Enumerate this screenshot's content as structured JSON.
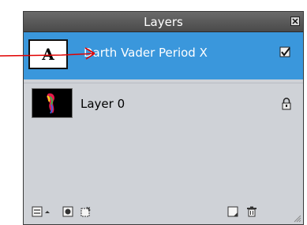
{
  "panel": {
    "title": "Layers"
  },
  "layers": [
    {
      "name": "Darth Vader Period X",
      "thumbnail": "A",
      "selected": true,
      "indicator": "check-icon"
    },
    {
      "name": "Layer 0",
      "selected": false,
      "indicator": "lock-icon"
    }
  ],
  "toolbar": {
    "icons": [
      "layer-options-icon",
      "new-mask-icon",
      "new-group-icon",
      "new-layer-icon",
      "trash-icon",
      "resize-grip-icon"
    ]
  },
  "colors": {
    "selected": "#3a97dc",
    "panel_bg": "#cfd2d7",
    "titlebar": "#555555",
    "annotation_arrow": "#e00000"
  }
}
